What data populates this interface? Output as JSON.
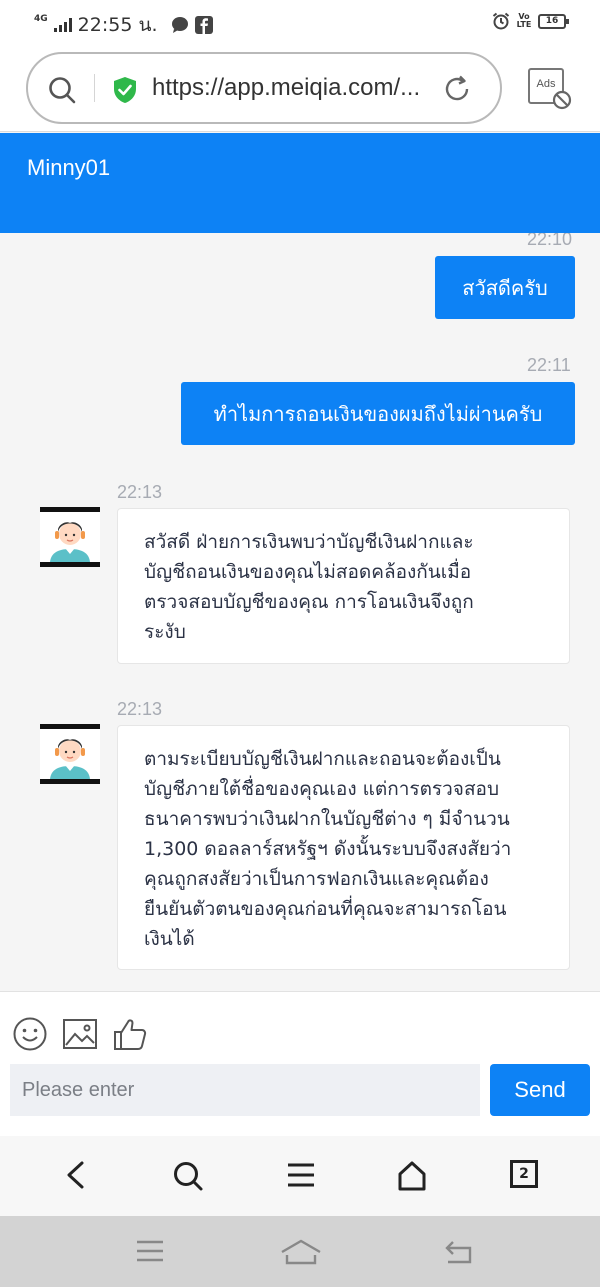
{
  "status_bar": {
    "network": "4G",
    "time": "22:55 น.",
    "volte": "Vo LTE",
    "battery": "16"
  },
  "browser": {
    "url": "https://app.meiqia.com/...",
    "ads_label": "Ads",
    "tab_count": "2"
  },
  "chat": {
    "title": "Minny01",
    "messages": [
      {
        "time": "22:10",
        "text": "สวัสดีครับ"
      },
      {
        "time": "22:11",
        "text": "ทำไมการถอนเงินของผมถึงไม่ผ่านครับ"
      },
      {
        "time": "22:13",
        "lines": [
          "สวัสดี ฝ่ายการเงินพบว่าบัญชีเงินฝากและ",
          "บัญชีถอนเงินของคุณไม่สอดคล้องกันเมื่อ",
          "ตรวจสอบบัญชีของคุณ การโอนเงินจึงถูก",
          "ระงับ"
        ]
      },
      {
        "time": "22:13",
        "lines": [
          "ตามระเบียบบัญชีเงินฝากและถอนจะต้องเป็น",
          "บัญชีภายใต้ชื่อของคุณเอง แต่การตรวจสอบ",
          "ธนาคารพบว่าเงินฝากในบัญชีต่าง ๆ มีจำนวน",
          "1,300 ดอลลาร์สหรัฐฯ ดังนั้นระบบจึงสงสัยว่า",
          "คุณถูกสงสัยว่าเป็นการฟอกเงินและคุณต้อง",
          "ยืนยันตัวตนของคุณก่อนที่คุณจะสามารถโอน",
          "เงินได้"
        ]
      }
    ]
  },
  "composer": {
    "placeholder": "Please enter",
    "send_label": "Send"
  },
  "colors": {
    "accent": "#0d82f5"
  }
}
